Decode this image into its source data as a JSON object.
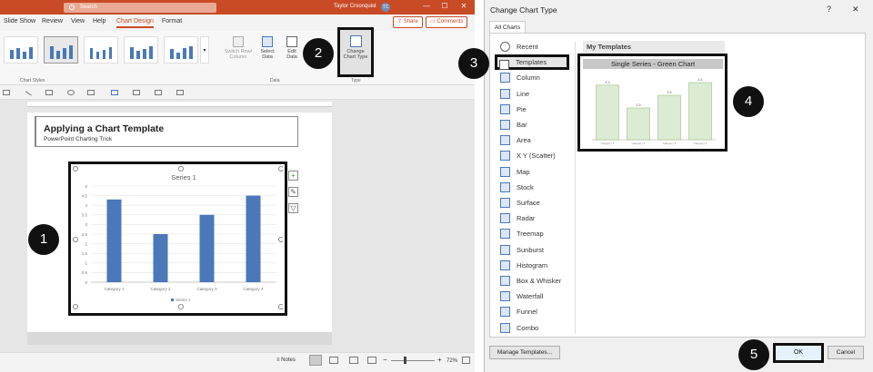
{
  "ppt": {
    "search_placeholder": "Search",
    "user_name": "Taylor Croonquist",
    "user_initials": "TC",
    "menu": [
      "Slide Show",
      "Review",
      "View",
      "Help",
      "Chart Design",
      "Format"
    ],
    "active_menu": "Chart Design",
    "share_label": "Share",
    "comments_label": "Comments",
    "chart_styles_label": "Chart Styles",
    "data_group_label": "Data",
    "type_group_label": "Type",
    "switch_row_col": "Switch Row/ Column",
    "select_data": "Select Data",
    "edit_data": "Edit Data",
    "change_chart_type": "Change Chart Type",
    "slide_title": "Applying a Chart Template",
    "slide_subtitle": "PowerPoint Charting Trick",
    "notes_label": "Notes",
    "zoom": "72%"
  },
  "chart_data": [
    {
      "type": "bar",
      "title": "Series 1",
      "categories": [
        "Category 1",
        "Category 2",
        "Category 3",
        "Category 4"
      ],
      "values": [
        4.3,
        2.5,
        3.5,
        4.5
      ],
      "ylim": [
        0,
        5
      ],
      "yticks": [
        "0",
        "0.5",
        "1",
        "1.5",
        "2",
        "2.5",
        "3",
        "3.5",
        "4",
        "4.5",
        "5"
      ],
      "legend": "Series 1",
      "color": "#4a78b8"
    },
    {
      "type": "bar",
      "title": "Single Series - Green Chart",
      "categories": [
        "Category 1",
        "Category 2",
        "Category 3",
        "Category 4"
      ],
      "values": [
        4.3,
        2.5,
        3.5,
        4.5
      ],
      "data_labels": [
        "4.3",
        "2.5",
        "3.5",
        "4.5"
      ],
      "color": "#dcebd3"
    }
  ],
  "dialog": {
    "title": "Change Chart Type",
    "help": "?",
    "close": "✕",
    "tab": "All Charts",
    "categories": [
      "Recent",
      "Templates",
      "Column",
      "Line",
      "Pie",
      "Bar",
      "Area",
      "X Y (Scatter)",
      "Map",
      "Stock",
      "Surface",
      "Radar",
      "Treemap",
      "Sunburst",
      "Histogram",
      "Box & Whisker",
      "Waterfall",
      "Funnel",
      "Combo"
    ],
    "selected_category": "Templates",
    "my_templates_header": "My Templates",
    "template_name": "Single Series - Green Chart",
    "manage_templates": "Manage Templates...",
    "ok": "OK",
    "cancel": "Cancel"
  },
  "steps": [
    "1",
    "2",
    "3",
    "4",
    "5"
  ]
}
